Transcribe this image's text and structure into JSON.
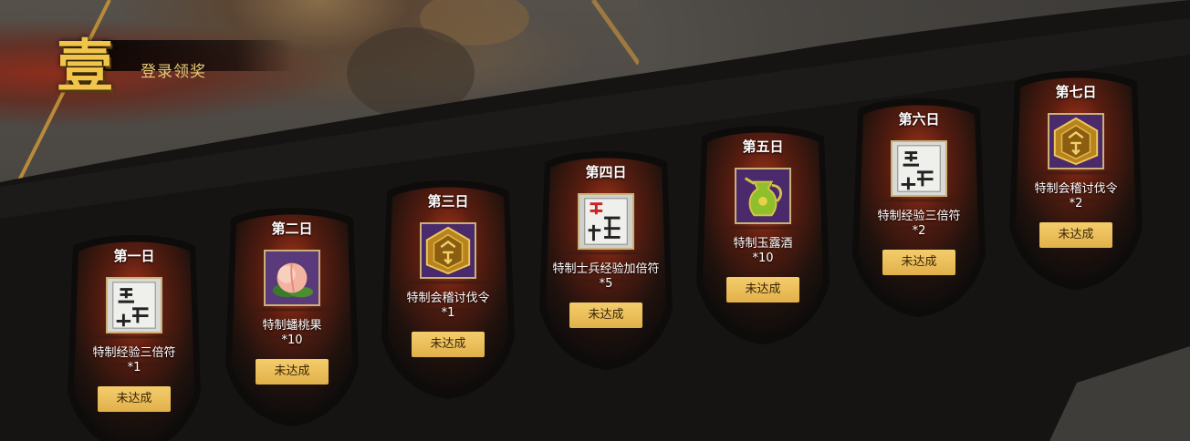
{
  "section": {
    "number_glyph": "壹",
    "title": "登录领奖"
  },
  "cards": [
    {
      "day": "第一日",
      "item": "特制经验三倍符",
      "qty": "*1",
      "icon": "exp-scroll-icon",
      "button": "未达成"
    },
    {
      "day": "第二日",
      "item": "特制蟠桃果",
      "qty": "*10",
      "icon": "peach-icon",
      "button": "未达成"
    },
    {
      "day": "第三日",
      "item": "特制会稽讨伐令",
      "qty": "*1",
      "icon": "command-token-icon",
      "button": "未达成"
    },
    {
      "day": "第四日",
      "item": "特制士兵经验加倍符",
      "qty": "*5",
      "icon": "soldier-exp-scroll-icon",
      "button": "未达成"
    },
    {
      "day": "第五日",
      "item": "特制玉露酒",
      "qty": "*10",
      "icon": "jade-wine-jug-icon",
      "button": "未达成"
    },
    {
      "day": "第六日",
      "item": "特制经验三倍符",
      "qty": "*2",
      "icon": "exp-scroll-icon",
      "button": "未达成"
    },
    {
      "day": "第七日",
      "item": "特制会稽讨伐令",
      "qty": "*2",
      "icon": "command-token-icon",
      "button": "未达成"
    }
  ],
  "colors": {
    "button_gold": "#e9bd57",
    "title_gold": "#f1c54a",
    "ember_red": "#b23a1c"
  }
}
